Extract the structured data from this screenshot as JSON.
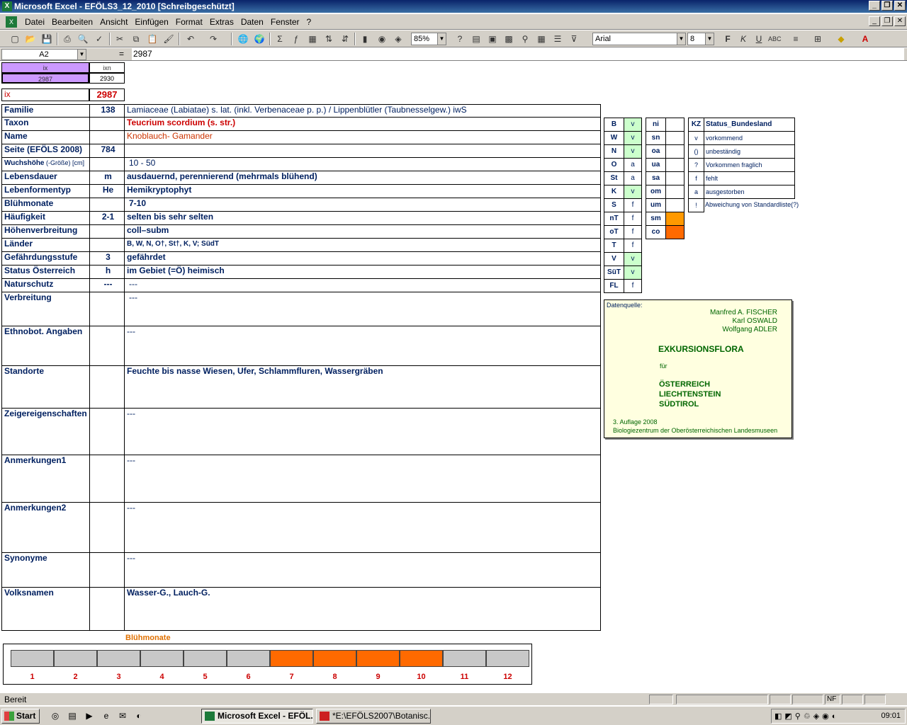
{
  "window": {
    "title": "Microsoft Excel - EFÖLS3_12_2010  [Schreibgeschützt]",
    "app_icon": "X"
  },
  "menu": [
    "Datei",
    "Bearbeiten",
    "Ansicht",
    "Einfügen",
    "Format",
    "Extras",
    "Daten",
    "Fenster",
    "?"
  ],
  "toolbar": {
    "zoom": "85%",
    "font": "Arial",
    "font_size": "8"
  },
  "formula_bar": {
    "cell_ref": "A2",
    "equals": "=",
    "value": "2987"
  },
  "top": {
    "ix_header": "ix",
    "ixn_header": "ixn",
    "ix_value": "2987",
    "ixn_value": "2930",
    "ix_label": "ix",
    "ix_big": "2987"
  },
  "rows": [
    {
      "label": "Familie",
      "code": "138",
      "value": "Lamiaceae (Labiatae) s. lat. (inkl. Verbenaceae p. p.)  /  Lippenblütler (Taubnesselgew.) iwS"
    },
    {
      "label": "Taxon",
      "code": "",
      "value": "Teucrium scordium (s. str.)"
    },
    {
      "label": "Name",
      "code": "",
      "value": "Knoblauch- Gamander"
    },
    {
      "label": "Seite (EFÖLS 2008)",
      "code": "784",
      "value": ""
    },
    {
      "label": "Wuchshöhe",
      "label_suffix": " (-Größe) [cm]",
      "code": "",
      "value": "10 - 50"
    },
    {
      "label": "Lebensdauer",
      "code": "m",
      "value": "ausdauernd, perennierend (mehrmals blühend)"
    },
    {
      "label": "Lebenformentyp",
      "code": "He",
      "value": "Hemikryptophyt"
    },
    {
      "label": "Blühmonate",
      "code": "",
      "value": "7-10"
    },
    {
      "label": "Häufigkeit",
      "code": "2-1",
      "value": "selten bis sehr selten"
    },
    {
      "label": "Höhenverbreitung",
      "code": "",
      "value": "coll–subm"
    },
    {
      "label": "Länder",
      "code": "",
      "value": "B, W, N, O†, St†, K, V; SüdT"
    },
    {
      "label": "Gefährdungsstufe",
      "code": "3",
      "value": "gefährdet"
    },
    {
      "label": "Status Österreich",
      "code": "h",
      "value": "im Gebiet (=Ö) heimisch"
    },
    {
      "label": "Naturschutz",
      "code": "---",
      "value": "---"
    },
    {
      "label": "Verbreitung",
      "code": "",
      "value": "---"
    },
    {
      "label": "Ethnobot. Angaben",
      "code": "",
      "value": "---"
    },
    {
      "label": "Standorte",
      "code": "",
      "value": "Feuchte bis nasse Wiesen, Ufer, Schlammfluren, Wassergräben"
    },
    {
      "label": "Zeigereigenschaften",
      "code": "",
      "value": "---"
    },
    {
      "label": "Anmerkungen1",
      "code": "",
      "value": "---"
    },
    {
      "label": "Anmerkungen2",
      "code": "",
      "value": "---"
    },
    {
      "label": "Synonyme",
      "code": "",
      "value": "---"
    },
    {
      "label": "Volksnamen",
      "code": "",
      "value": "Wasser-G., Lauch-G."
    }
  ],
  "states": [
    {
      "k": "B",
      "v": "v"
    },
    {
      "k": "W",
      "v": "v"
    },
    {
      "k": "N",
      "v": "v"
    },
    {
      "k": "O",
      "v": "a"
    },
    {
      "k": "St",
      "v": "a"
    },
    {
      "k": "K",
      "v": "v"
    },
    {
      "k": "S",
      "v": "f"
    },
    {
      "k": "nT",
      "v": "f"
    },
    {
      "k": "oT",
      "v": "f"
    },
    {
      "k": "T",
      "v": "f"
    },
    {
      "k": "V",
      "v": "v"
    },
    {
      "k": "SüT",
      "v": "v"
    },
    {
      "k": "FL",
      "v": "f"
    }
  ],
  "zones": [
    {
      "k": "ni",
      "v": ""
    },
    {
      "k": "sn",
      "v": ""
    },
    {
      "k": "oa",
      "v": ""
    },
    {
      "k": "ua",
      "v": ""
    },
    {
      "k": "sa",
      "v": ""
    },
    {
      "k": "om",
      "v": ""
    },
    {
      "k": "um",
      "v": ""
    },
    {
      "k": "sm",
      "v": "orange"
    },
    {
      "k": "co",
      "v": "darkorange"
    }
  ],
  "legend": {
    "header_k": "KZ",
    "header_v": "Status_Bundesland",
    "items": [
      {
        "k": "v",
        "v": "vorkommend"
      },
      {
        "k": "()",
        "v": "unbeständig"
      },
      {
        "k": "?",
        "v": "Vorkommen fraglich"
      },
      {
        "k": "f",
        "v": "fehlt"
      },
      {
        "k": "a",
        "v": "ausgestorben"
      },
      {
        "k": "!",
        "v": "Abweichung von Standardliste(?)"
      }
    ]
  },
  "source_box": {
    "label": "Datenquelle:",
    "authors": [
      "Manfred A. FISCHER",
      "Karl OSWALD",
      "Wolfgang ADLER"
    ],
    "title": "EXKURSIONSFLORA",
    "fuer": "für",
    "countries": [
      "ÖSTERREICH",
      "LIECHTENSTEIN",
      "SÜDTIROL"
    ],
    "edition": "3. Auflage 2008",
    "publisher": "Biologiezentrum der Oberösterreichischen Landesmuseen"
  },
  "bloom": {
    "title": "Blühmonate",
    "months": [
      "1",
      "2",
      "3",
      "4",
      "5",
      "6",
      "7",
      "8",
      "9",
      "10",
      "11",
      "12"
    ],
    "active": [
      false,
      false,
      false,
      false,
      false,
      false,
      true,
      true,
      true,
      true,
      false,
      false
    ],
    "active_color": "#ff6a00",
    "inactive_color": "#c8c8c8"
  },
  "status": {
    "text": "Bereit",
    "nf": "NF"
  },
  "taskbar": {
    "start": "Start",
    "tasks": [
      "Microsoft Excel - EFÖL...",
      "*E:\\EFÖLS2007\\Botanisc..."
    ],
    "clock": "09:01"
  },
  "colors": {
    "green_cell": "#ccffcc",
    "header_purple": "#cc99ff",
    "ix_red": "#cc0000",
    "navy_text": "#002060",
    "source_bg": "#ffffe0",
    "source_green": "#006600"
  }
}
